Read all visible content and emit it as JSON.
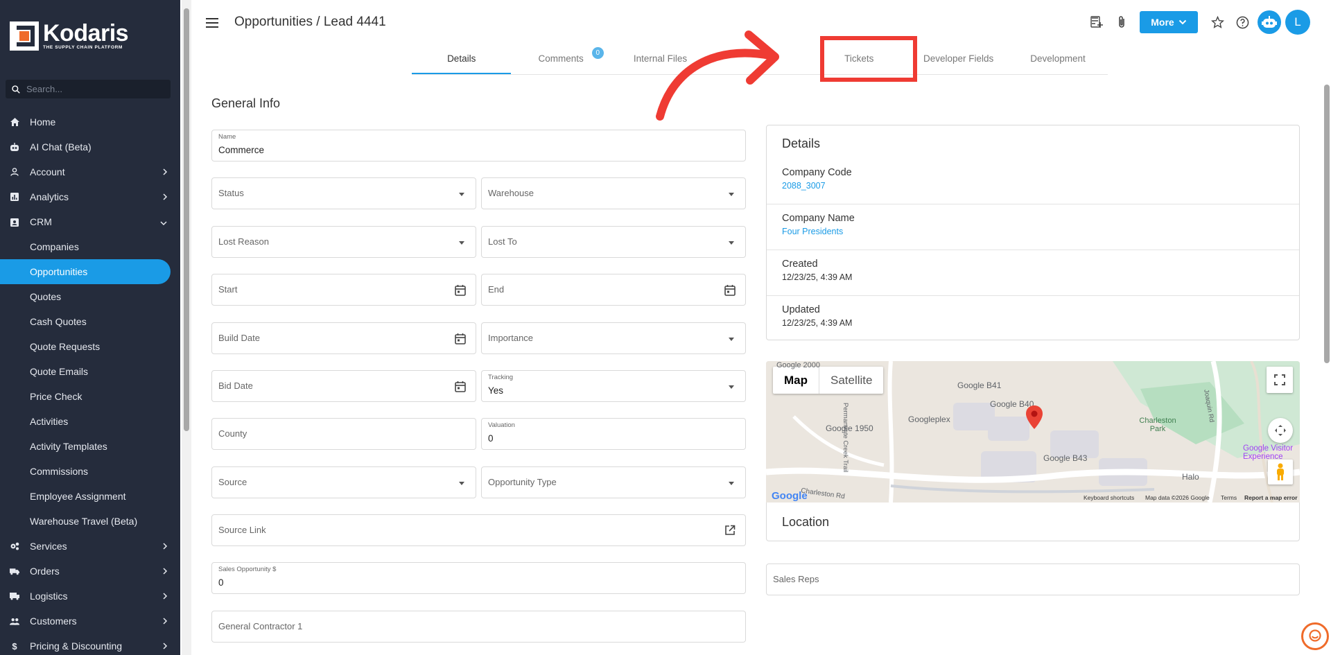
{
  "app": {
    "brand": "Kodaris",
    "tagline": "THE SUPPLY CHAIN PLATFORM"
  },
  "search": {
    "placeholder": "Search..."
  },
  "nav": {
    "home": "Home",
    "ai_chat": "AI Chat (Beta)",
    "account": "Account",
    "analytics": "Analytics",
    "crm": "CRM",
    "crm_items": [
      "Companies",
      "Opportunities",
      "Quotes",
      "Cash Quotes",
      "Quote Requests",
      "Quote Emails",
      "Price Check",
      "Activities",
      "Activity Templates",
      "Commissions",
      "Employee Assignment",
      "Warehouse Travel (Beta)"
    ],
    "services": "Services",
    "orders": "Orders",
    "logistics": "Logistics",
    "customers": "Customers",
    "pricing": "Pricing & Discounting"
  },
  "header": {
    "title": "Opportunities / Lead 4441",
    "more_label": "More",
    "avatar_initial": "L"
  },
  "tabs": [
    {
      "label": "Details"
    },
    {
      "label": "Comments",
      "badge": "0"
    },
    {
      "label": "Internal Files"
    },
    {
      "label": ""
    },
    {
      "label": "Tickets"
    },
    {
      "label": "Developer Fields"
    },
    {
      "label": "Development"
    }
  ],
  "general": {
    "title": "General Info",
    "name_label": "Name",
    "name_value": "Commerce",
    "status": "Status",
    "warehouse": "Warehouse",
    "lost_reason": "Lost Reason",
    "lost_to": "Lost To",
    "start": "Start",
    "end": "End",
    "build_date": "Build Date",
    "importance": "Importance",
    "bid_date": "Bid Date",
    "tracking_label": "Tracking",
    "tracking_value": "Yes",
    "county": "County",
    "valuation_label": "Valuation",
    "valuation_value": "0",
    "source": "Source",
    "opportunity_type": "Opportunity Type",
    "source_link": "Source Link",
    "sales_opp_label": "Sales Opportunity $",
    "sales_opp_value": "0",
    "general_contractor": "General Contractor 1"
  },
  "details_card": {
    "title": "Details",
    "company_code_label": "Company Code",
    "company_code_value": "2088_3007",
    "company_name_label": "Company Name",
    "company_name_value": "Four Presidents",
    "created_label": "Created",
    "created_value": "12/23/25, 4:39 AM",
    "updated_label": "Updated",
    "updated_value": "12/23/25, 4:39 AM"
  },
  "map": {
    "map_btn": "Map",
    "satellite_btn": "Satellite",
    "labels": [
      "Google 2000",
      "Google B41",
      "Google B40",
      "Googleplex",
      "Google 1950",
      "Charleston Park",
      "Google Visitor Experience",
      "Google B43",
      "Halo",
      "Permanente Creek Trail",
      "Joaquin Rd",
      "Charleston Rd"
    ],
    "footer": [
      "Keyboard shortcuts",
      "Map data ©2026 Google",
      "Terms",
      "Report a map error"
    ],
    "logo": "Google"
  },
  "location": {
    "title": "Location"
  },
  "sales_reps": {
    "label": "Sales Reps"
  },
  "colors": {
    "accent": "#1a9be6",
    "sidebar": "#252c3c",
    "highlight": "#ef3b33"
  }
}
